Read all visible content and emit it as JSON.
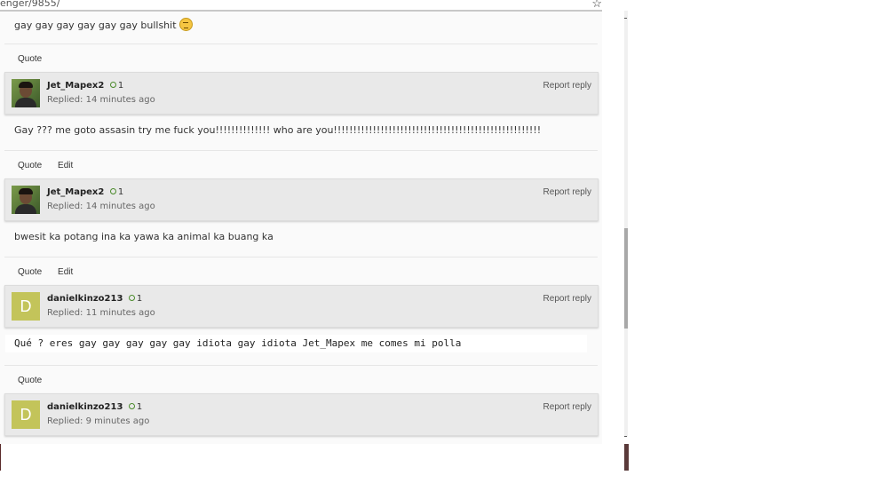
{
  "browser": {
    "url": "enger/9855/",
    "star_icon": "star-icon"
  },
  "posts": [
    {
      "text": "gay gay gay gay gay gay bullshit",
      "has_emoji": true,
      "emoji_icon": "unamused-face-icon",
      "actions": [
        "Quote"
      ]
    },
    {
      "author": "Jet_Mapex2",
      "reputation": "1",
      "replied": "Replied: 14 minutes ago",
      "report": "Report reply",
      "avatar": "photo",
      "text": "Gay ??? me goto assasin try me fuck you!!!!!!!!!!!!!! who are you!!!!!!!!!!!!!!!!!!!!!!!!!!!!!!!!!!!!!!!!!!!!!!!!!!!!!",
      "actions": [
        "Quote",
        "Edit"
      ]
    },
    {
      "author": "Jet_Mapex2",
      "reputation": "1",
      "replied": "Replied: 14 minutes ago",
      "report": "Report reply",
      "avatar": "photo",
      "text": "bwesit ka potang ina ka yawa ka animal ka buang ka",
      "actions": [
        "Quote",
        "Edit"
      ]
    },
    {
      "author": "danielkinzo213",
      "reputation": "1",
      "replied": "Replied: 11 minutes ago",
      "report": "Report reply",
      "avatar": "letter",
      "avatar_letter": "D",
      "text": "Qué ? eres gay gay gay gay gay idiota gay idiota Jet_Mapex me comes mi polla",
      "actions": [
        "Quote"
      ]
    },
    {
      "author": "danielkinzo213",
      "reputation": "1",
      "replied": "Replied: 9 minutes ago",
      "report": "Report reply",
      "avatar": "letter",
      "avatar_letter": "D"
    }
  ],
  "colors": {
    "header_bg": "#e9e9e9",
    "letter_avatar_bg": "#c3c45a",
    "reputation_green": "#4a8a2a"
  }
}
